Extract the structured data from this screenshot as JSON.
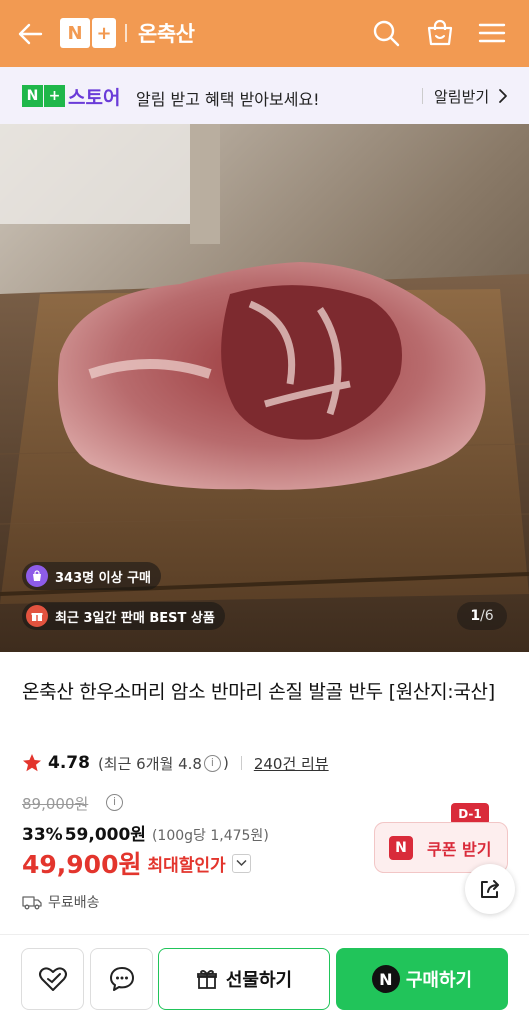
{
  "header": {
    "logo_left": "N",
    "logo_right": "+",
    "title": "온축산"
  },
  "notice": {
    "store_logo_n": "N",
    "store_logo_plus": "+",
    "store_name": "스토어",
    "message": "알림 받고 혜택 받아보세요!",
    "action": "알림받기"
  },
  "gallery": {
    "buyers_badge": "343명 이상 구매",
    "best_badge": "최근 3일간 판매 BEST 상품",
    "current_index": "1",
    "total": "/6"
  },
  "product": {
    "title": "온축산 한우소머리 암소 반마리 손질 발골 반두 [원산지:국산]",
    "rating": "4.78",
    "recent_rating": "(최근 6개월 4.8",
    "recent_rating_close": ")",
    "info_glyph": "i",
    "review_count": "240건 리뷰",
    "original_price": "89,000원",
    "discount_rate": "33%",
    "discount_price": "59,000원",
    "unit_price": "(100g당 1,475원)",
    "final_price": "49,900원",
    "final_label": "최대할인가",
    "shipping": "무료배송"
  },
  "coupon": {
    "badge": "D-1",
    "icon_letter": "N",
    "label": "쿠폰 받기"
  },
  "actions": {
    "gift": "선물하기",
    "buy_logo": "N",
    "buy": "구매하기"
  },
  "colors": {
    "header_bg": "#f29a52",
    "accent_green": "#21c45a",
    "sale_red": "#e3352d",
    "store_purple": "#6a3bd8"
  }
}
